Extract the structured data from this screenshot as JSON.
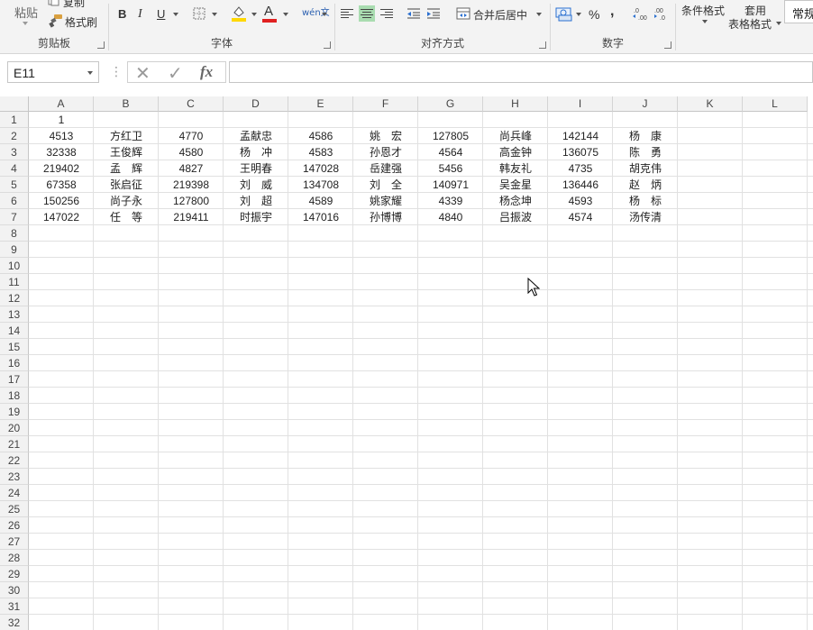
{
  "ribbon": {
    "paste_label": "粘贴",
    "copy_label": "复制",
    "format_painter_label": "格式刷",
    "groups": {
      "clipboard": "剪贴板",
      "font": "字体",
      "alignment": "对齐方式",
      "number": "数字"
    },
    "font_buttons": {
      "bold": "B",
      "italic": "I",
      "underline": "U",
      "font_color": "A"
    },
    "phonetic_label": "wén文",
    "merge_center_label": "合并后居中",
    "percent_label": "%",
    "comma_label": ",",
    "conditional_format_label": "条件格式",
    "table_format_label_1": "套用",
    "table_format_label_2": "表格格式",
    "number_format_value": "常规",
    "colors": {
      "fill_highlight": "#ffd800",
      "font_red": "#e02020",
      "align_active": "#a9dcb0"
    }
  },
  "formula_bar": {
    "name_box": "E11",
    "dots": "⋮",
    "cancel_icon": "✕",
    "enter_icon": "✓",
    "fx_label": "fx",
    "formula_value": ""
  },
  "sheet": {
    "columns": [
      "A",
      "B",
      "C",
      "D",
      "E",
      "F",
      "G",
      "H",
      "I",
      "J",
      "K",
      "L"
    ],
    "row_numbers": [
      "1",
      "2",
      "3",
      "4",
      "5",
      "6",
      "7",
      "8",
      "9",
      "10",
      "11",
      "12",
      "13",
      "14",
      "15",
      "16",
      "17",
      "18",
      "19",
      "20",
      "21",
      "22",
      "23",
      "24",
      "25",
      "26",
      "27",
      "28",
      "29",
      "30",
      "31",
      "32"
    ],
    "rows": [
      [
        "1",
        "",
        "",
        "",
        "",
        "",
        "",
        "",
        "",
        ""
      ],
      [
        "4513",
        "方红卫",
        "4770",
        "孟献忠",
        "4586",
        "姚　宏",
        "127805",
        "尚兵峰",
        "142144",
        "杨　康"
      ],
      [
        "32338",
        "王俊辉",
        "4580",
        "杨　冲",
        "4583",
        "孙恩才",
        "4564",
        "高金钟",
        "136075",
        "陈　勇"
      ],
      [
        "219402",
        "孟　辉",
        "4827",
        "王明春",
        "147028",
        "岳建强",
        "5456",
        "韩友礼",
        "4735",
        "胡克伟"
      ],
      [
        "67358",
        "张启征",
        "219398",
        "刘　威",
        "134708",
        "刘　全",
        "140971",
        "吴金星",
        "136446",
        "赵　炳"
      ],
      [
        "150256",
        "尚子永",
        "127800",
        "刘　超",
        "4589",
        "姚家耀",
        "4339",
        "杨念坤",
        "4593",
        "杨　标"
      ],
      [
        "147022",
        "任　等",
        "219411",
        "时振宇",
        "147016",
        "孙博博",
        "4840",
        "吕振波",
        "4574",
        "汤传清"
      ]
    ]
  }
}
